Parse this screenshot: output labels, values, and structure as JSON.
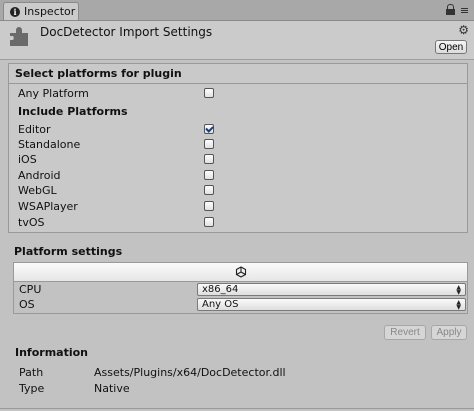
{
  "window": {
    "tab_label": "Inspector"
  },
  "header": {
    "title": "DocDetector Import Settings",
    "open_label": "Open"
  },
  "platforms": {
    "section_title": "Select platforms for plugin",
    "any_platform": {
      "label": "Any Platform",
      "checked": false
    },
    "include_title": "Include Platforms",
    "items": [
      {
        "label": "Editor",
        "checked": true
      },
      {
        "label": "Standalone",
        "checked": false
      },
      {
        "label": "iOS",
        "checked": false
      },
      {
        "label": "Android",
        "checked": false
      },
      {
        "label": "WebGL",
        "checked": false
      },
      {
        "label": "WSAPlayer",
        "checked": false
      },
      {
        "label": "tvOS",
        "checked": false
      }
    ]
  },
  "platform_settings": {
    "title": "Platform settings",
    "active_tab_icon": "unity-icon",
    "cpu": {
      "label": "CPU",
      "value": "x86_64"
    },
    "os": {
      "label": "OS",
      "value": "Any OS"
    }
  },
  "actions": {
    "revert_label": "Revert",
    "apply_label": "Apply"
  },
  "information": {
    "title": "Information",
    "path": {
      "label": "Path",
      "value": "Assets/Plugins/x64/DocDetector.dll"
    },
    "type": {
      "label": "Type",
      "value": "Native"
    }
  },
  "colors": {
    "background": "#c2c2c2",
    "check": "#1c3b7d"
  }
}
